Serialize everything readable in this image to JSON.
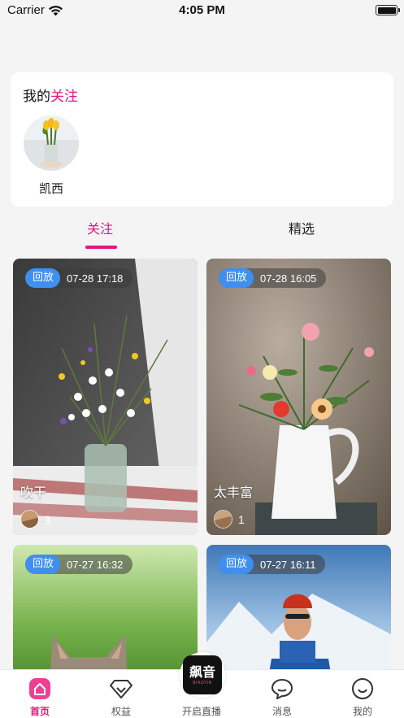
{
  "status_bar": {
    "carrier": "Carrier",
    "time": "4:05 PM",
    "battery_level": 1.0
  },
  "follow_section": {
    "title_prefix": "我的",
    "title_highlight": "关注",
    "users": [
      {
        "name": "凯西"
      }
    ]
  },
  "tabs": [
    {
      "label": "关注",
      "active": true
    },
    {
      "label": "精选",
      "active": false
    }
  ],
  "cards": [
    {
      "replay_label": "回放",
      "time": "07-28 17:18",
      "title": "吹干",
      "viewers": "1"
    },
    {
      "replay_label": "回放",
      "time": "07-28 16:05",
      "title": "太丰富",
      "viewers": "1"
    },
    {
      "replay_label": "回放",
      "time": "07-27 16:32",
      "title": "",
      "viewers": ""
    },
    {
      "replay_label": "回放",
      "time": "07-27 16:11",
      "title": "",
      "viewers": ""
    }
  ],
  "tab_bar": {
    "home": "首页",
    "rights": "权益",
    "live": "开启直播",
    "live_logo_text": "飙音",
    "live_logo_sub": "BIAOYIN",
    "messages": "消息",
    "mine": "我的"
  },
  "colors": {
    "accent": "#e3177e",
    "replay_badge": "#3f8ff0"
  }
}
